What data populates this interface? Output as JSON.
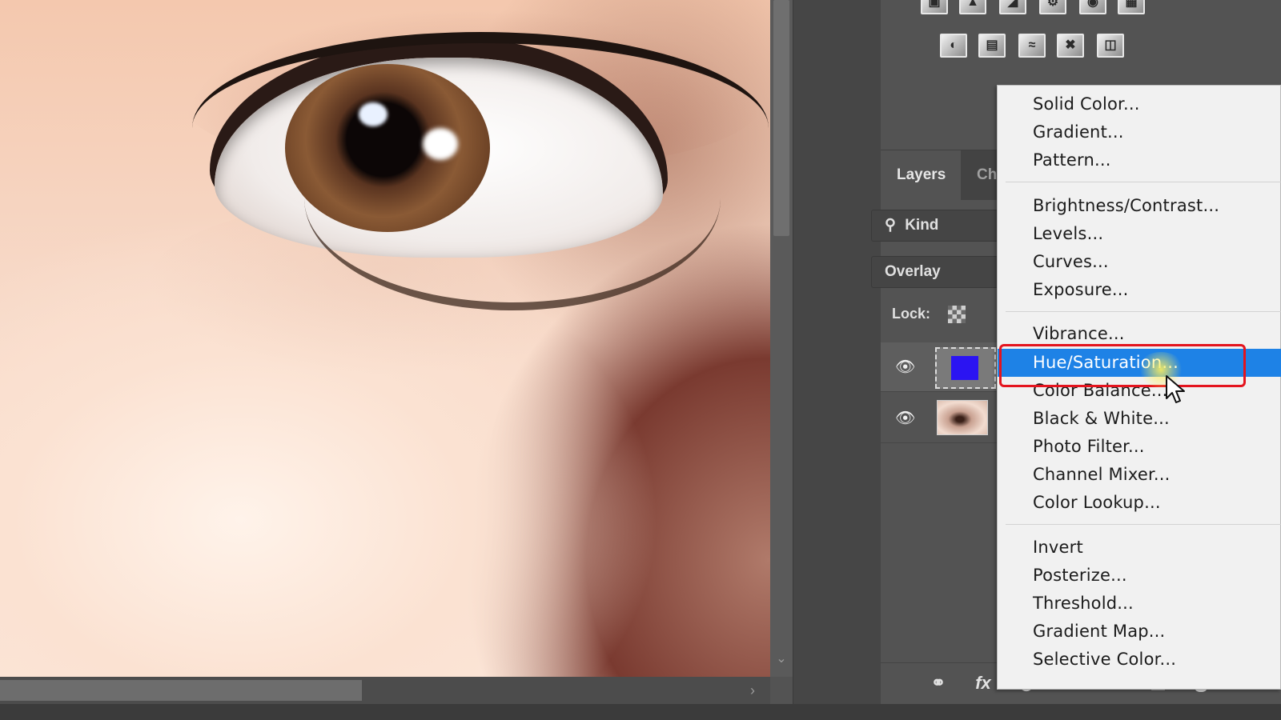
{
  "panels": {
    "layers_tab": "Layers",
    "channels_tab": "Ch",
    "filter_kind": "Kind",
    "blend_mode": "Overlay",
    "lock_label": "Lock:"
  },
  "layers": [
    {
      "type": "solid-color-fill",
      "swatch_color": "#2b14f2",
      "selected": true
    },
    {
      "type": "photo",
      "selected": false
    }
  ],
  "adjustments_icons": {
    "row1": [
      "brightness-icon",
      "levels-icon",
      "curves-icon",
      "exposure-icon",
      "vibrance-icon",
      "grid-icon"
    ],
    "row2": [
      "invert-icon",
      "posterize-icon",
      "threshold-icon",
      "selective-color-icon",
      "gradient-map-icon"
    ]
  },
  "menu": {
    "groups": [
      [
        "Solid Color...",
        "Gradient...",
        "Pattern..."
      ],
      [
        "Brightness/Contrast...",
        "Levels...",
        "Curves...",
        "Exposure..."
      ],
      [
        "Vibrance...",
        "Hue/Saturation...",
        "Color Balance...",
        "Black & White...",
        "Photo Filter...",
        "Channel Mixer...",
        "Color Lookup..."
      ],
      [
        "Invert",
        "Posterize...",
        "Threshold...",
        "Gradient Map...",
        "Selective Color..."
      ]
    ],
    "highlighted": "Hue/Saturation..."
  },
  "footer_icons": [
    "link-layers-icon",
    "fx-icon",
    "add-mask-icon",
    "new-adjustment-layer-icon",
    "new-group-icon",
    "new-layer-icon",
    "delete-layer-icon"
  ],
  "colors": {
    "menu_highlight": "#1e82e6",
    "annotation_ring": "#e4141e"
  }
}
